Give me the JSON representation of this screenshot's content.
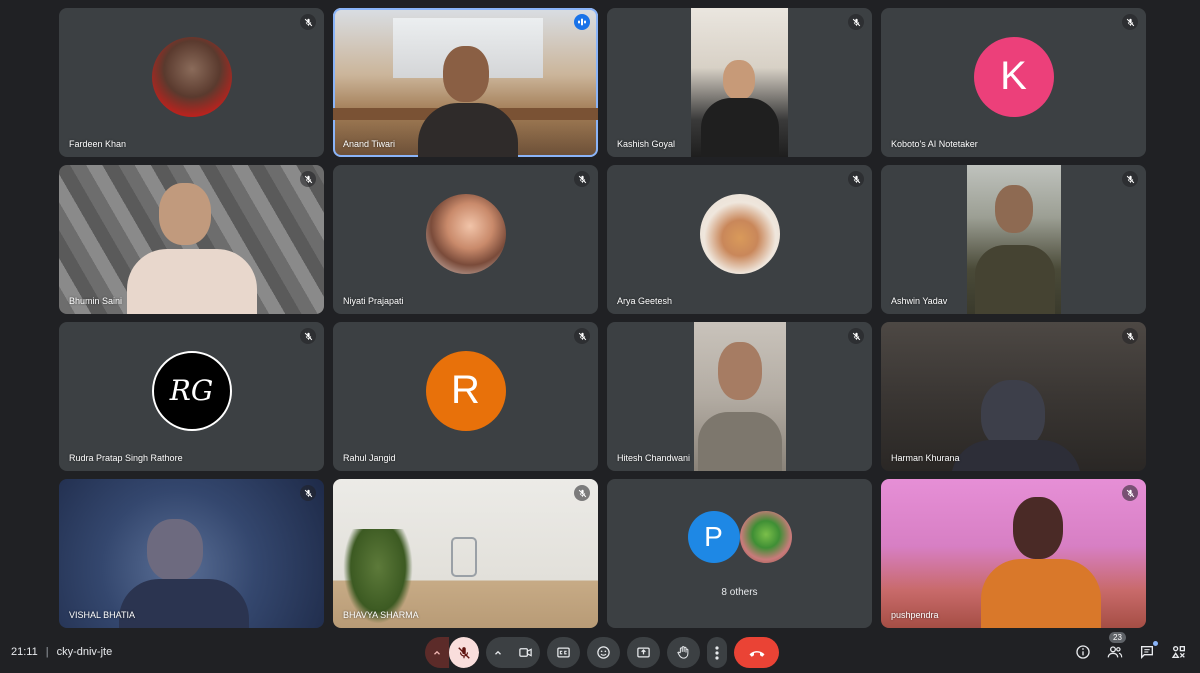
{
  "meeting": {
    "time": "21:11",
    "code": "cky-dniv-jte",
    "participant_count": "23"
  },
  "participants": [
    {
      "name": "Fardeen Khan"
    },
    {
      "name": "Anand Tiwari"
    },
    {
      "name": "Kashish Goyal"
    },
    {
      "name": "Koboto's AI Notetaker",
      "initial": "K",
      "color": "#ec407a"
    },
    {
      "name": "Bhumin Saini"
    },
    {
      "name": "Niyati Prajapati"
    },
    {
      "name": "Arya Geetesh"
    },
    {
      "name": "Ashwin Yadav"
    },
    {
      "name": "Rudra Pratap Singh Rathore",
      "logo": "RG"
    },
    {
      "name": "Rahul Jangid",
      "initial": "R",
      "color": "#e8710a"
    },
    {
      "name": "Hitesh Chandwani"
    },
    {
      "name": "Harman Khurana"
    },
    {
      "name": "VISHAL BHATIA"
    },
    {
      "name": "BHAVYA SHARMA"
    },
    {
      "label": "8 others",
      "initial": "P",
      "color": "#1e88e5"
    },
    {
      "name": "pushpendra"
    }
  ],
  "icons": {
    "mute": "mic-off-icon",
    "speaking": "audio-bars-icon",
    "camera": "videocam-icon",
    "captions": "closed-caption-icon",
    "emoji": "emoji-icon",
    "present": "present-screen-icon",
    "hand": "raise-hand-icon",
    "more": "more-vert-icon",
    "hangup": "call-end-icon",
    "info": "info-icon",
    "people": "people-icon",
    "chat": "chat-icon",
    "activities": "activities-icon"
  },
  "colors": {
    "background": "#202124",
    "tile": "#3c4043",
    "hangup": "#ea4335",
    "speaking": "#8ab4f8"
  }
}
